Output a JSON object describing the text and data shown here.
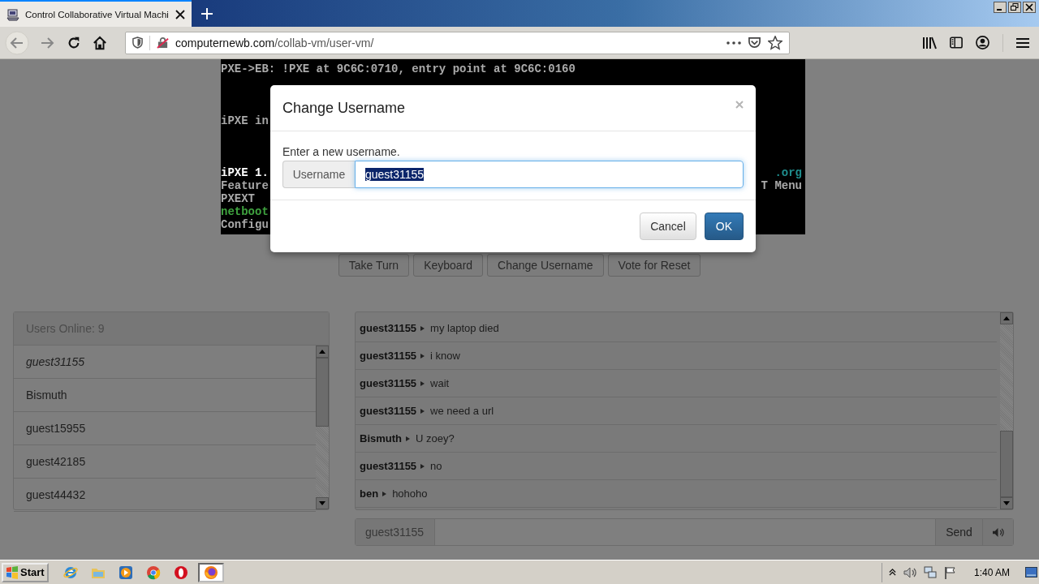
{
  "browser": {
    "tab": {
      "title": "Control Collaborative Virtual Machi",
      "selected": true
    },
    "url": {
      "host": "computernewb.com",
      "path": "/collab-vm/user-vm/"
    }
  },
  "terminal": {
    "blocks": [
      [
        {
          "text": "PXE->EB: !PXE at 9C6C:0710, entry point at 9C6C:0160",
          "color": "#aaaaaa"
        }
      ],
      [
        {
          "text": "iPXE in",
          "color": "#aaaaaa"
        }
      ],
      [
        {
          "text": "iPXE 1.",
          "color": "#ffffff",
          "right": {
            "text": ".org",
            "color": "#1f8f8f"
          }
        },
        {
          "text": "Feature",
          "color": "#aaaaaa",
          "right": {
            "text": "T Menu",
            "color": "#aaaaaa"
          }
        },
        {
          "text": "PXEXT",
          "color": "#aaaaaa"
        },
        {
          "text": "netboot",
          "color": "#3fa33f"
        },
        {
          "text": "Configu",
          "color": "#aaaaaa"
        }
      ]
    ]
  },
  "vm_buttons": [
    "Take Turn",
    "Keyboard",
    "Change Username",
    "Vote for Reset"
  ],
  "users": {
    "header": "Users Online: 9",
    "items": [
      {
        "name": "guest31155",
        "current": true
      },
      {
        "name": "Bismuth",
        "current": false
      },
      {
        "name": "guest15955",
        "current": false
      },
      {
        "name": "guest42185",
        "current": false
      },
      {
        "name": "guest44432",
        "current": false
      }
    ]
  },
  "chat": {
    "messages": [
      {
        "user": "guest31155",
        "text": "my laptop died"
      },
      {
        "user": "guest31155",
        "text": "i know"
      },
      {
        "user": "guest31155",
        "text": "wait"
      },
      {
        "user": "guest31155",
        "text": "we need a url"
      },
      {
        "user": "Bismuth",
        "text": "U zoey?"
      },
      {
        "user": "guest31155",
        "text": "no"
      },
      {
        "user": "ben",
        "text": "hohoho"
      }
    ],
    "username": "guest31155",
    "send": "Send"
  },
  "dialog": {
    "title": "Change Username",
    "prompt": "Enter a new username.",
    "addon": "Username",
    "value": "guest31155",
    "value_selected": true,
    "buttons": [
      {
        "label": "Cancel",
        "kind": "default"
      },
      {
        "label": "OK",
        "kind": "primary"
      }
    ]
  },
  "taskbar": {
    "start": "Start",
    "apps": [
      {
        "kind": "ie",
        "selected": false
      },
      {
        "kind": "explorer",
        "selected": false
      },
      {
        "kind": "media",
        "selected": false
      },
      {
        "kind": "chrome",
        "selected": false
      },
      {
        "kind": "opera",
        "selected": false
      },
      {
        "kind": "firefox",
        "selected": true
      }
    ],
    "clock": "1:40 AM"
  }
}
